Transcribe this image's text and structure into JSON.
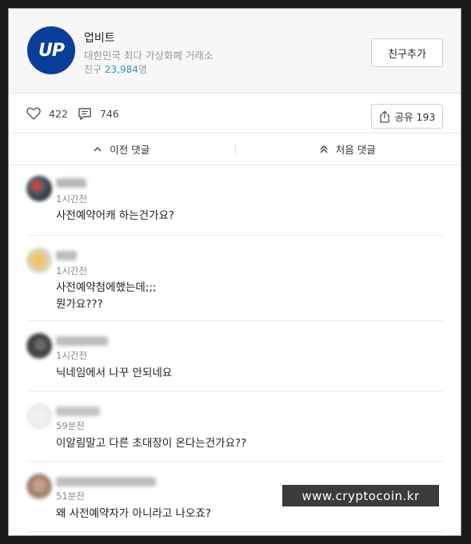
{
  "channel": {
    "logo_text": "UP",
    "logo_color": "#0a3d9a",
    "name": "업비트",
    "description": "대한민국 최다 가상화폐 거래소",
    "friends_label": "친구",
    "friends_count": "23,984",
    "friends_suffix": "명",
    "add_friend_label": "친구추가"
  },
  "reactions": {
    "like_icon": "heart-icon",
    "like_count": "422",
    "comment_icon": "comment-icon",
    "comment_count": "746",
    "share_icon": "share-icon",
    "share_label": "공유 193"
  },
  "nav": {
    "prev_label": "이전 댓글",
    "first_label": "처음 댓글"
  },
  "comments": [
    {
      "time": "1시간전",
      "text": "사전예약어캐 하는건가요?"
    },
    {
      "time": "1시간전",
      "text": "사전예약첨에했는데;;;",
      "text2": "뭔가요???"
    },
    {
      "time": "1시간전",
      "text": "닉네임에서 나꾸 안되네요"
    },
    {
      "time": "59분전",
      "text": "이알림말고 다른 초대장이 온다는건가요??"
    },
    {
      "time": "51분전",
      "text": "왜 사전예약자가 아니라고 나오죠?"
    }
  ],
  "watermark": "www.cryptocoin.kr",
  "colors": {
    "accent_link": "#3a91c9",
    "header_bg": "#f7f7f7"
  }
}
